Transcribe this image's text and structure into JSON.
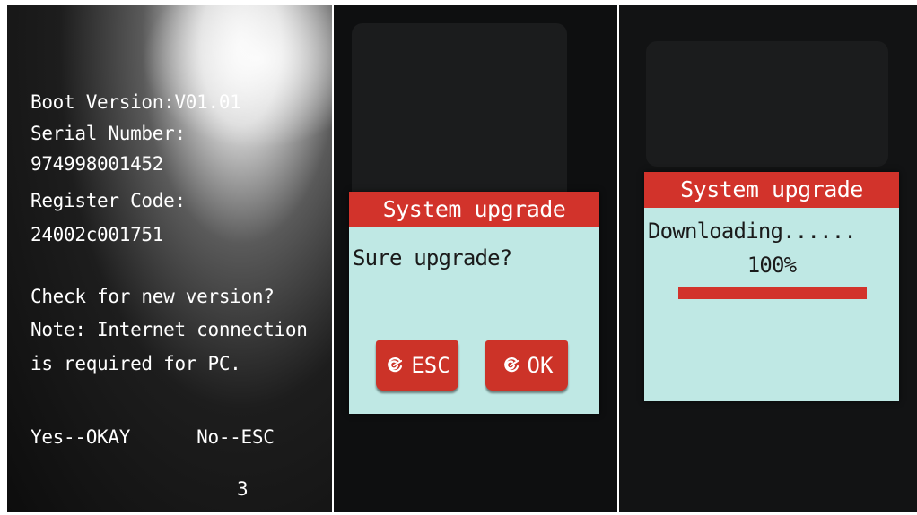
{
  "boot_screen": {
    "lines": [
      "Boot Version:V01.01",
      "Serial Number:",
      "974998001452",
      "Register Code:",
      "24002c001751",
      "Check for new version?",
      "Note: Internet connection",
      "is required for PC.",
      "Yes--OKAY      No--ESC",
      "3"
    ]
  },
  "confirm_dialog": {
    "title": "System upgrade",
    "message": "Sure upgrade?",
    "esc_label": "ESC",
    "ok_label": "OK",
    "button_icon": "swirl-icon"
  },
  "progress_dialog": {
    "title": "System upgrade",
    "status": "Downloading......",
    "percent_label": "100%",
    "progress": 1.0
  },
  "colors": {
    "accent_red": "#d2332b",
    "lcd_background": "#bfe8e4",
    "boot_text": "#ffffff"
  }
}
